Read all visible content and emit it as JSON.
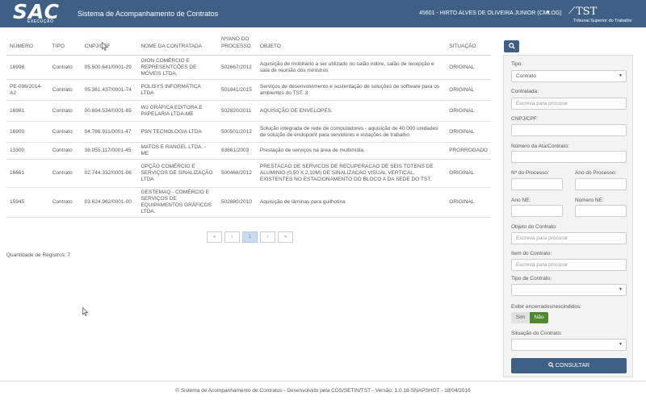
{
  "header": {
    "logo_text": "SAC",
    "logo_subtext": "EXECUÇÃO",
    "title": "Sistema de Acompanhamento de Contratos",
    "user": "45601 - HIRTO ALVES DE OLIVEIRA JUNIOR (CMLOG)",
    "org_name": "TST",
    "org_subtitle": "Tribunal Superior do Trabalho",
    "bg_color": "#3f5f84"
  },
  "table": {
    "columns": [
      "NÚMERO",
      "TIPO",
      "CNPJ/CPF",
      "NOME DA CONTRATADA",
      "Nº/ANO DO PROCESSO",
      "OBJETO",
      "SITUAÇÃO"
    ],
    "rows": [
      {
        "numero": "16998",
        "tipo": "Contrato",
        "cnpj": "05.500.641/0001-29",
        "nome": "GION COMÉRCIO E REPRESENTCÕES DE MÓVEIS LTDA.",
        "processo": "502667/2012",
        "objeto": "Aquisição de mobiliário a ser utilizado no salão nobre, salão de recepção e sala de reunião dos ministros",
        "situacao": "ORIGINAL"
      },
      {
        "numero": "PE-096/2014-A2",
        "tipo": "Contrato",
        "cnpj": "05.361.437/0001-74",
        "nome": "POLISYS INFORMÁTICA LTDA",
        "processo": "501841/2015",
        "objeto": "Serviços de desenvolvimento e sustentação de soluções de software para os ambientes do TST. 3",
        "situacao": "ORIGINAL"
      },
      {
        "numero": "16981",
        "tipo": "Contrato",
        "cnpj": "00.694.534/0001-65",
        "nome": "WJ GRÁFICA EDITORA E PAPELARIA LTDA-ME",
        "processo": "502820/2011",
        "objeto": "AQUISIÇÃO DE ENVELOPES.",
        "situacao": "ORIGINAL"
      },
      {
        "numero": "16900",
        "tipo": "Contrato",
        "cnpj": "04.786.911/0001-47",
        "nome": "PSN TECNOLOGIA LTDA",
        "processo": "500501/2012",
        "objeto": "Solução integrada de rede de computadores - aquisição de 40.000 unidades de solução de endopoint para servidores e estações de trabalho.",
        "situacao": "ORIGINAL"
      },
      {
        "numero": "13300",
        "tipo": "Contrato",
        "cnpj": "38.055.117/0001-45",
        "nome": "MATOS E RANGEL LTDA. - ME",
        "processo": "63661/2003",
        "objeto": "Prestação de serviços na área de multimídia.",
        "situacao": "PRORROGADO"
      },
      {
        "numero": "16661",
        "tipo": "Contrato",
        "cnpj": "02.744.332/0001-06",
        "nome": "OPÇÃO COMÉRCIO E SERVIÇOS DE SINALIZAÇÃO LTDA",
        "processo": "500466/2012",
        "objeto": "PRESTACAO DE SERVICOS DE RECUPERACAO DE SEIS TOTENS DE ALUMINIO (0,50 X 2,10M) DE SINALIZACAO VISUAL VERTICAL, EXISTENTES NO ESTACIONAMENTO DO BLOCO A DA SEDE DO TST.",
        "situacao": "ORIGINAL"
      },
      {
        "numero": "15945",
        "tipo": "Contrato",
        "cnpj": "03.624.962/0001-00",
        "nome": "GESTEMAQ - COMÉRCIO E SERVIÇOS DE EQUIPAMENTOS GRÁFICOS LTDA.",
        "processo": "502880/2010",
        "objeto": "Aquisição de lâminas para guilhotina",
        "situacao": "ORIGINAL"
      }
    ]
  },
  "pagination": {
    "first": "«",
    "prev": "‹",
    "current": "1",
    "next": "›",
    "last": "»"
  },
  "record_count": "Quantidade de Registros: 7",
  "filters": {
    "search_icon": "search-icon",
    "tipo_label": "Tipo:",
    "tipo_value": "Contrato",
    "contratada_label": "Contratada:",
    "contratada_placeholder": "Escreva para procurar",
    "cnpj_label": "CNPJ/CPF:",
    "ata_label": "Número da Ata/Contrato:",
    "processo_label": "Nº do Processo:",
    "ano_processo_label": "Ano do Processo:",
    "ano_ne_label": "Ano NE:",
    "numero_ne_label": "Número NE:",
    "objeto_label": "Objeto do Contrato:",
    "objeto_placeholder": "Escreva para procurar",
    "item_label": "Item do Contrato:",
    "item_placeholder": "Escreva para procurar",
    "tipo_contrato_label": "Tipo de Contrato:",
    "encerrados_label": "Exibir encerrados/rescindidos:",
    "sim": "Sim",
    "nao": "Não",
    "situacao_label": "Situação do Contrato:",
    "consultar": "CONSULTAR"
  },
  "footer": "© Sistema de Acompanhamento de Contratos - Desenvolvido pela CDS/SETIN/TST - Versão: 1.0.18-SNAPSHOT - 18/04/2016"
}
